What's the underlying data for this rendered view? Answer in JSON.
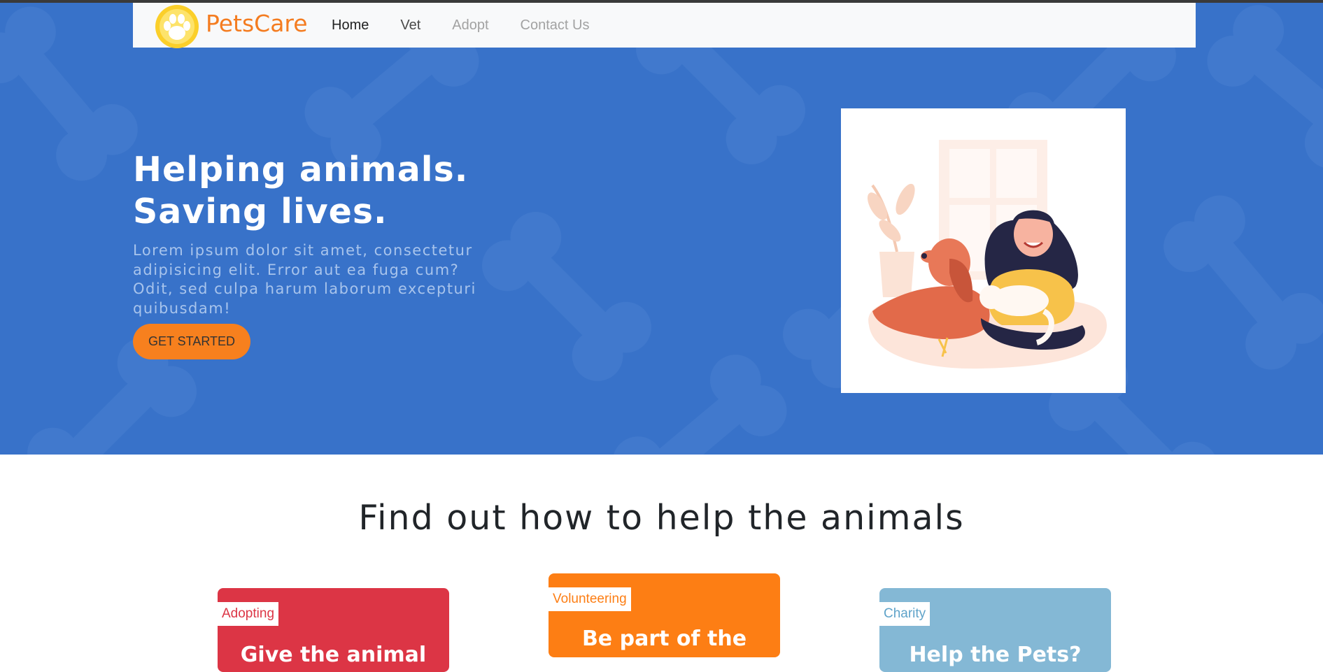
{
  "brand": {
    "name": "PetsCare"
  },
  "nav": {
    "home": "Home",
    "vet": "Vet",
    "adopt": "Adopt",
    "contact": "Contact Us"
  },
  "hero": {
    "title_line1": "Helping animals.",
    "title_line2": "Saving lives.",
    "text": "Lorem ipsum dolor sit amet, consectetur adipisicing elit. Error aut ea fuga cum? Odit, sed culpa harum laborum excepturi quibusdam!",
    "cta": "GET STARTED"
  },
  "section": {
    "title": "Find out how to help the animals"
  },
  "cards": [
    {
      "tag": "Adopting",
      "title": "Give the animal"
    },
    {
      "tag": "Volunteering",
      "title": "Be part of the"
    },
    {
      "tag": "Charity",
      "title": "Help the Pets?"
    }
  ],
  "colors": {
    "hero_bg": "#3872c9",
    "accent_orange": "#f7801e",
    "card_red": "#dc3545",
    "card_orange": "#fd7e14",
    "card_blue": "#84b8d5"
  }
}
